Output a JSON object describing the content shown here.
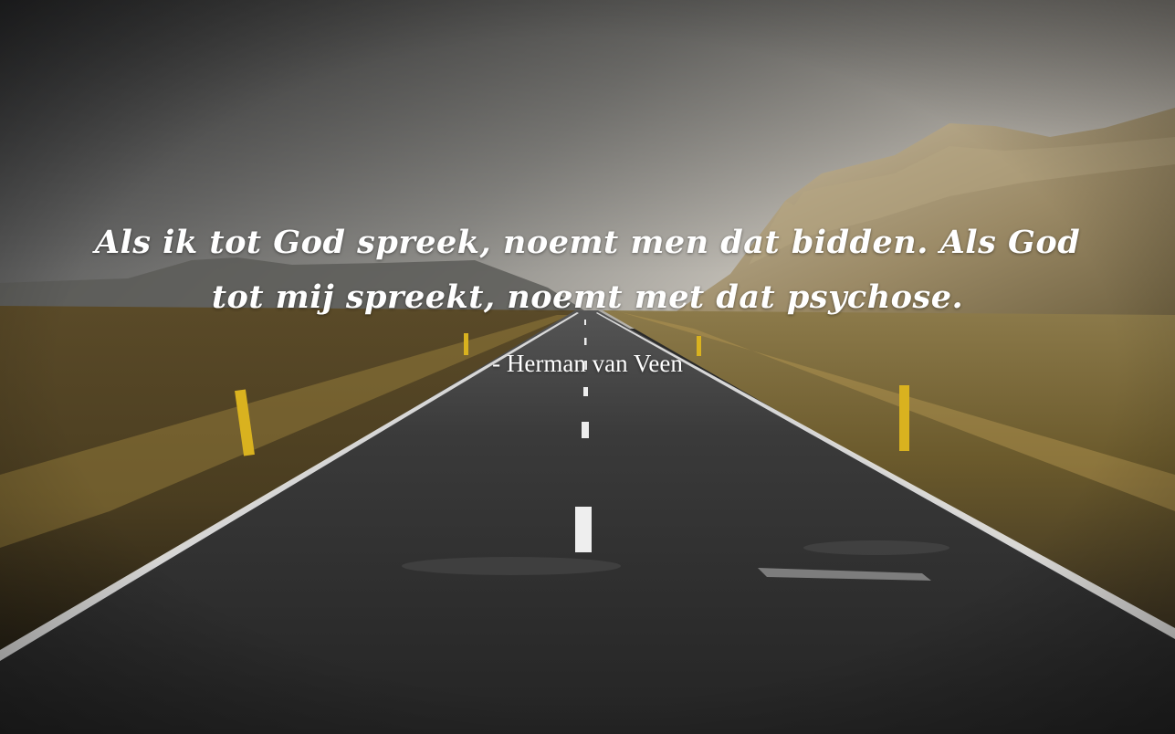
{
  "quote": {
    "text": "Als ik tot God spreek, noemt men dat bidden. Als God tot mij spreekt, noemt met dat psychose.",
    "author": "- Herman van Veen"
  },
  "colors": {
    "sky_top": "#4a4a4a",
    "sky_bottom": "#c9c2b6",
    "mountain": "#8a7a5c",
    "field": "#6b5a2e",
    "road": "#2b2b2b",
    "text": "#ffffff"
  }
}
